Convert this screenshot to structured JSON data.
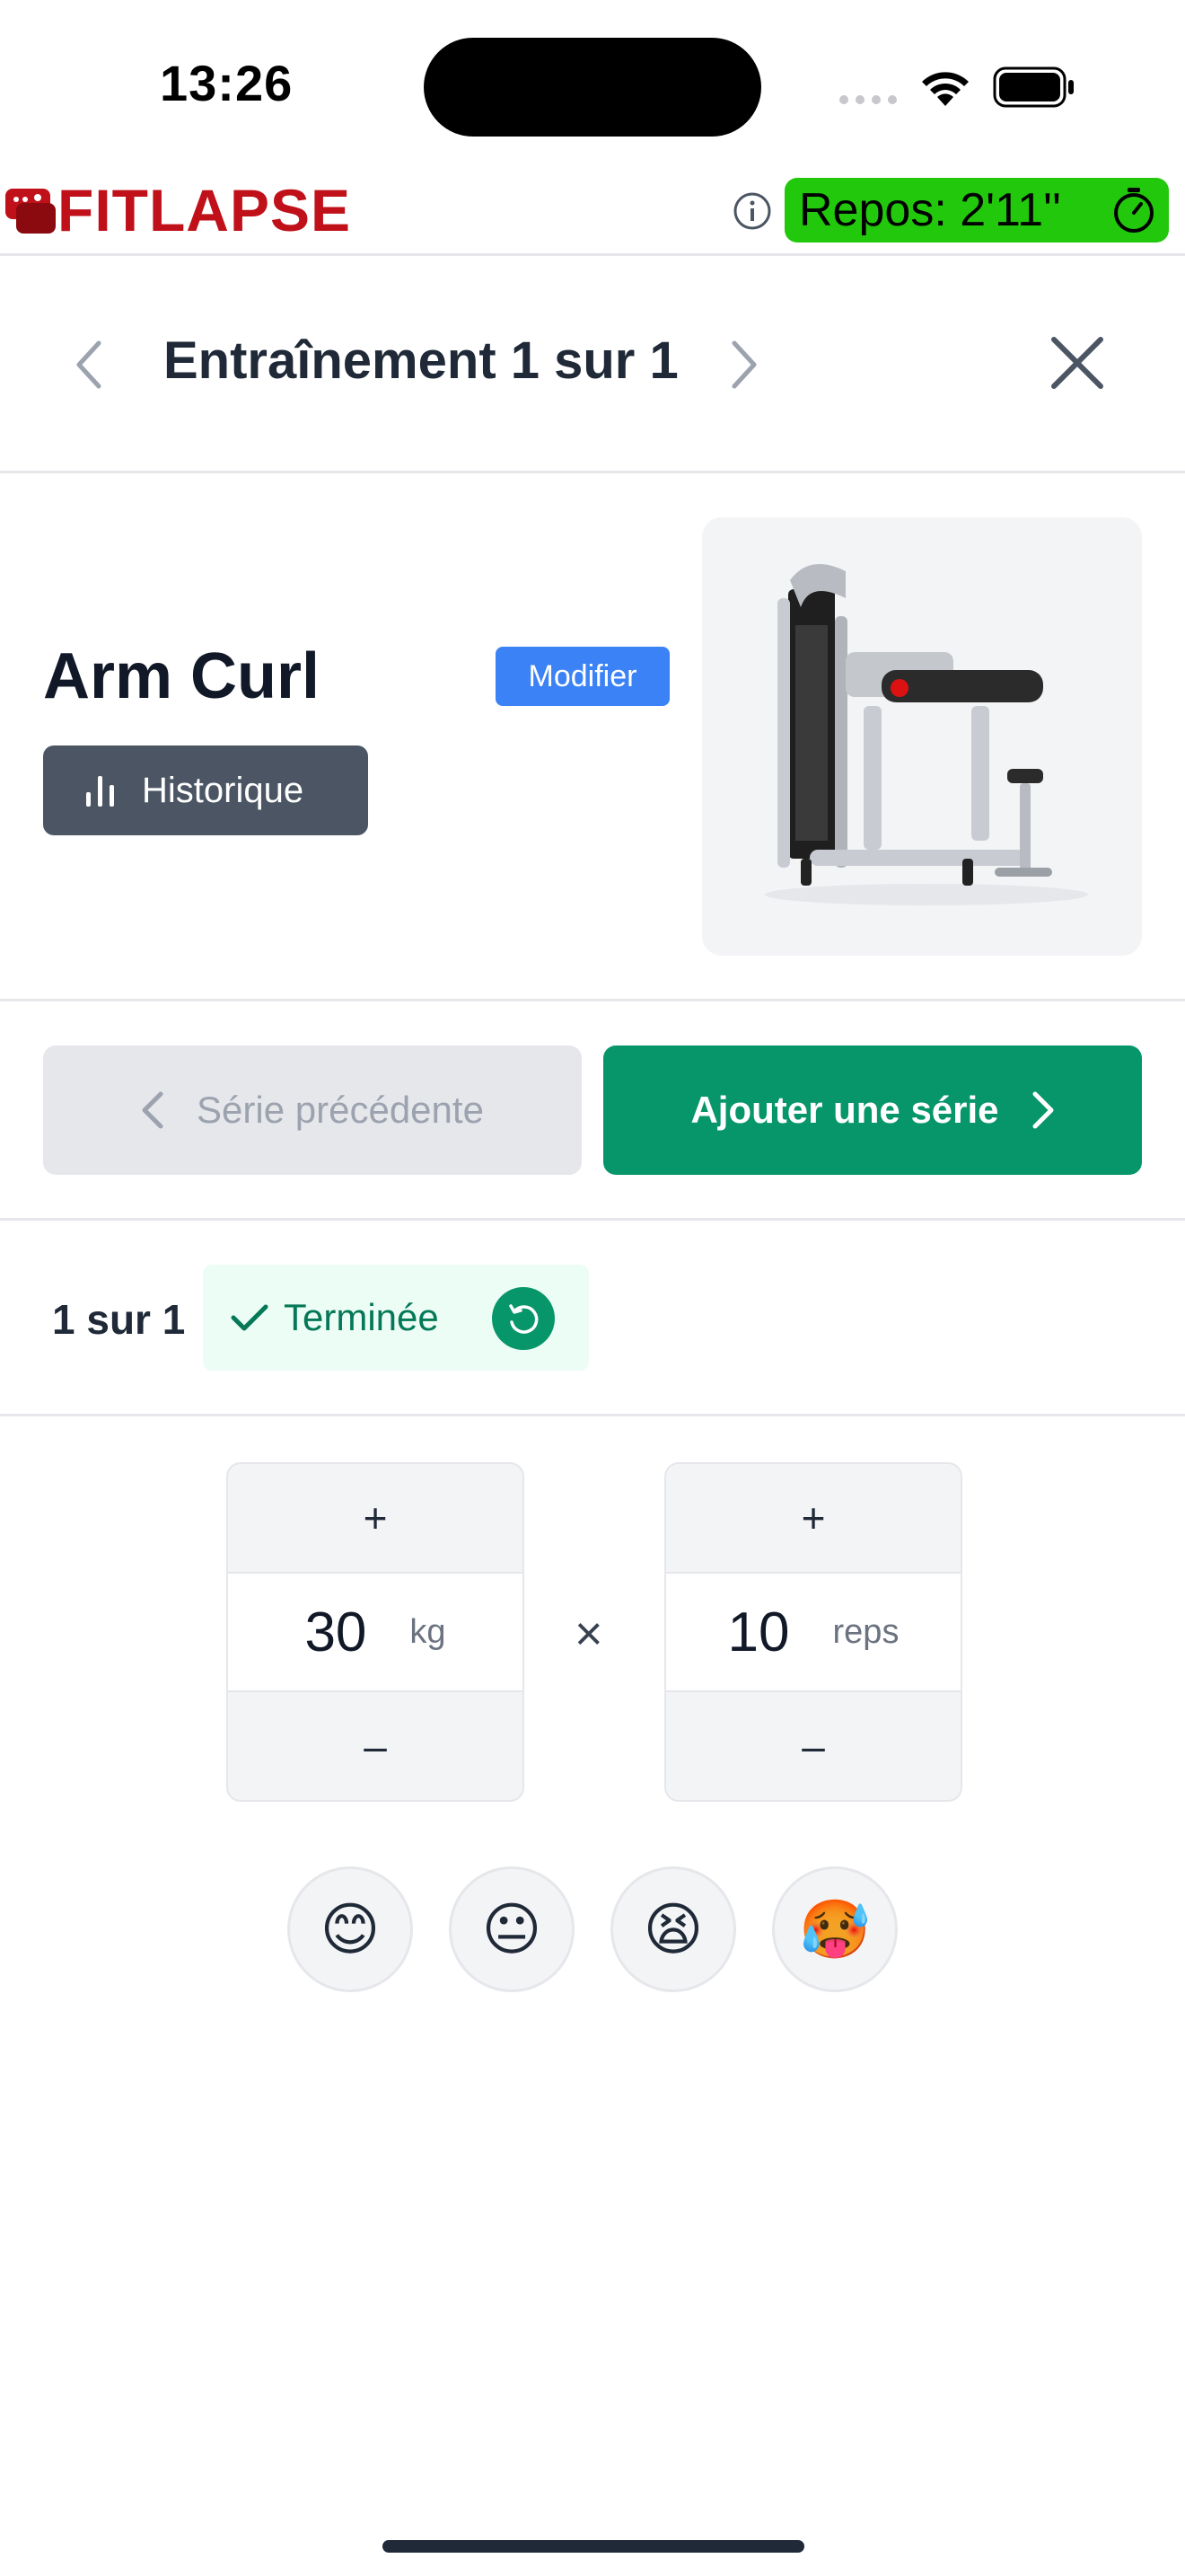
{
  "status_bar": {
    "time": "13:26"
  },
  "app_header": {
    "brand": "FITLAPSE",
    "rest_timer": "Repos: 2'11''",
    "colors": {
      "brand": "#c0101a",
      "timer_bg": "#22c80b"
    }
  },
  "nav": {
    "title": "Entraînement 1 sur 1"
  },
  "exercise": {
    "name": "Arm Curl",
    "modify_label": "Modifier",
    "history_label": "Historique"
  },
  "actions": {
    "prev_label": "Série précédente",
    "next_label": "Ajouter une série"
  },
  "set": {
    "count": "1 sur 1",
    "status": "Terminée"
  },
  "inputs": {
    "weight": {
      "plus": "+",
      "value": "30",
      "unit": "kg",
      "minus": "–"
    },
    "times": "×",
    "reps": {
      "plus": "+",
      "value": "10",
      "unit": "reps",
      "minus": "–"
    }
  },
  "feedback": [
    {
      "emoji": "😊"
    },
    {
      "emoji": "😐"
    },
    {
      "emoji": "😫"
    },
    {
      "emoji": "🥵"
    }
  ],
  "accent_colors": {
    "primary": "#079669",
    "modify": "#3b82f6",
    "history": "#4b5563"
  }
}
